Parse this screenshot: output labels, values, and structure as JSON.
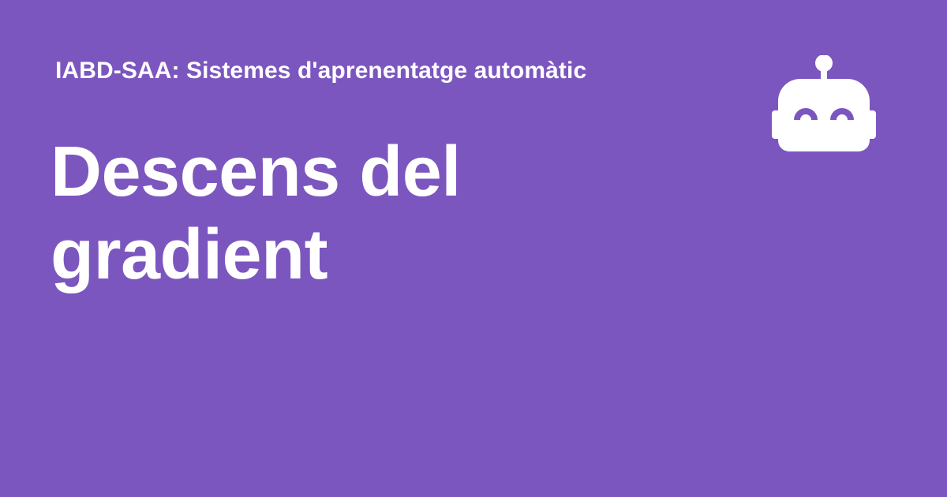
{
  "page": {
    "background_color": "#7c56bf",
    "text_color": "#ffffff"
  },
  "header": {
    "course_title": "IABD-SAA: Sistemes d'aprenentatge automàtic"
  },
  "main": {
    "title": "Descens del gradient"
  },
  "logo": {
    "icon": "robot-icon",
    "color": "#ffffff"
  }
}
